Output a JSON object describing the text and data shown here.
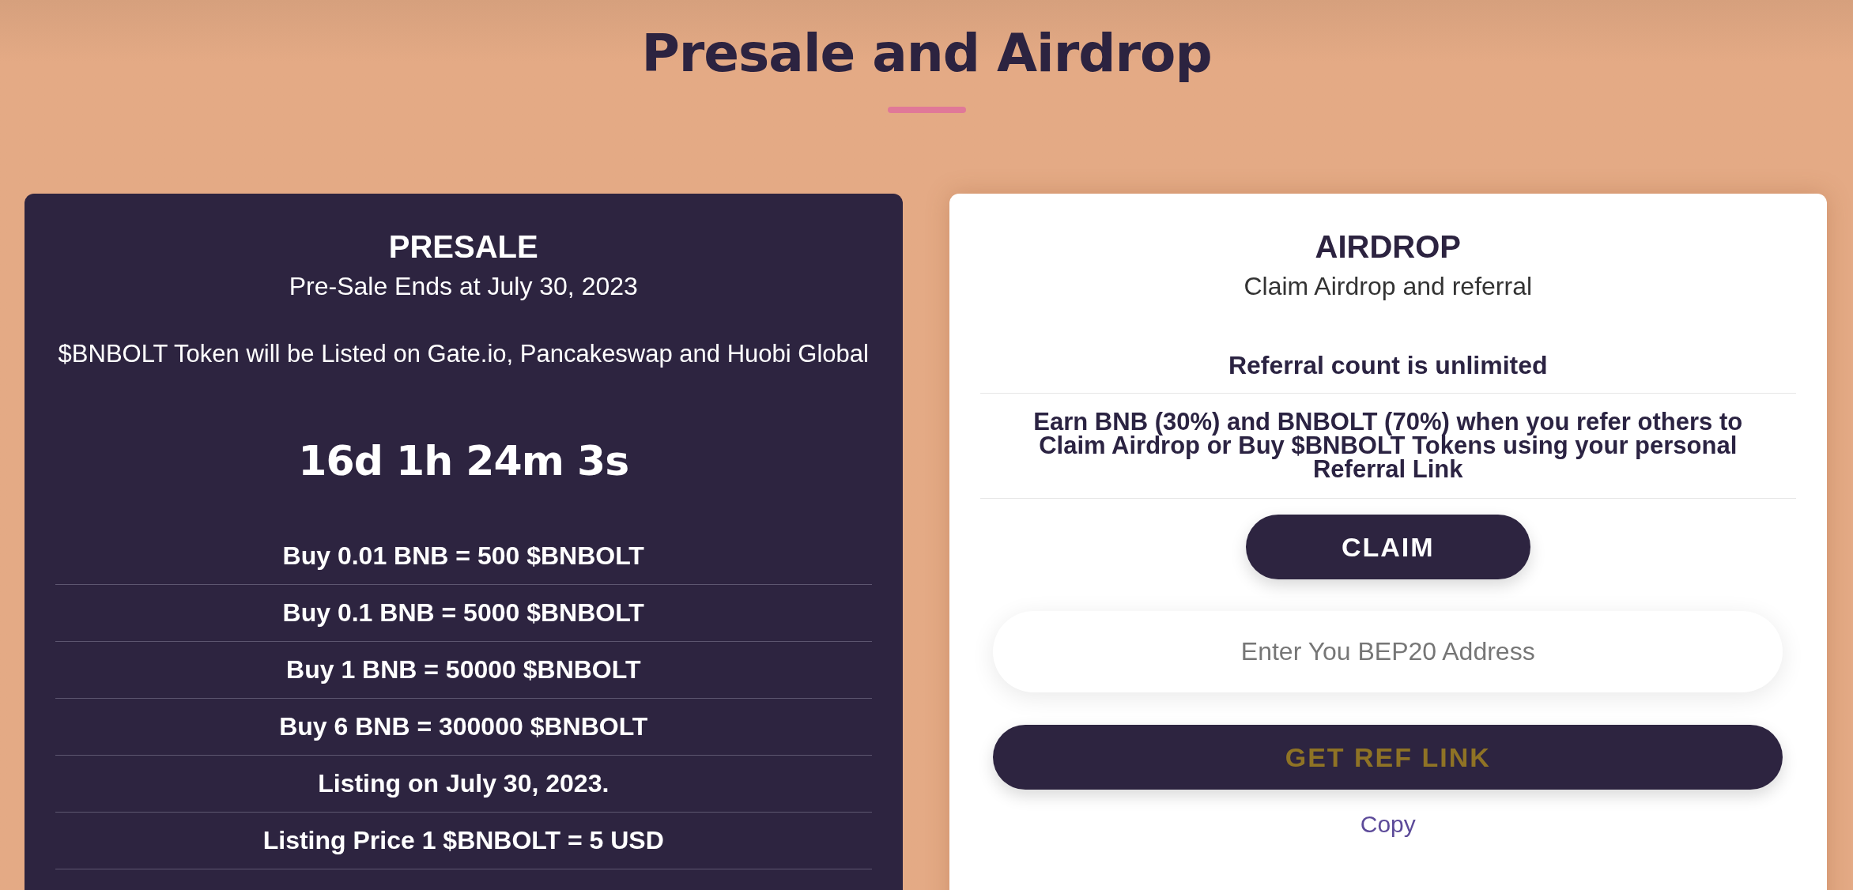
{
  "page": {
    "title": "Presale and Airdrop"
  },
  "presale": {
    "title": "PRESALE",
    "subtitle": "Pre-Sale Ends at July 30, 2023",
    "note": "$BNBOLT Token will be Listed on Gate.io, Pancakeswap and Huobi Global",
    "countdown": "16d 1h 24m 3s",
    "rows": [
      "Buy 0.01 BNB = 500 $BNBOLT",
      "Buy 0.1 BNB = 5000 $BNBOLT",
      "Buy 1 BNB = 50000 $BNBOLT",
      "Buy 6 BNB = 300000 $BNBOLT",
      "Listing on July 30, 2023.",
      "Listing Price 1 $BNBOLT = 5 USD"
    ]
  },
  "airdrop": {
    "title": "AIRDROP",
    "subtitle": "Claim Airdrop and referral",
    "rows": [
      "Referral count is unlimited",
      "Earn BNB (30%) and BNBOLT (70%) when you refer others to Claim Airdrop or Buy $BNBOLT Tokens using your personal Referral Link"
    ],
    "claim_button": "CLAIM",
    "address_field": {
      "placeholder": "Enter You BEP20 Address"
    },
    "ref_button": "GET REF LINK",
    "copy_link": "Copy"
  }
}
